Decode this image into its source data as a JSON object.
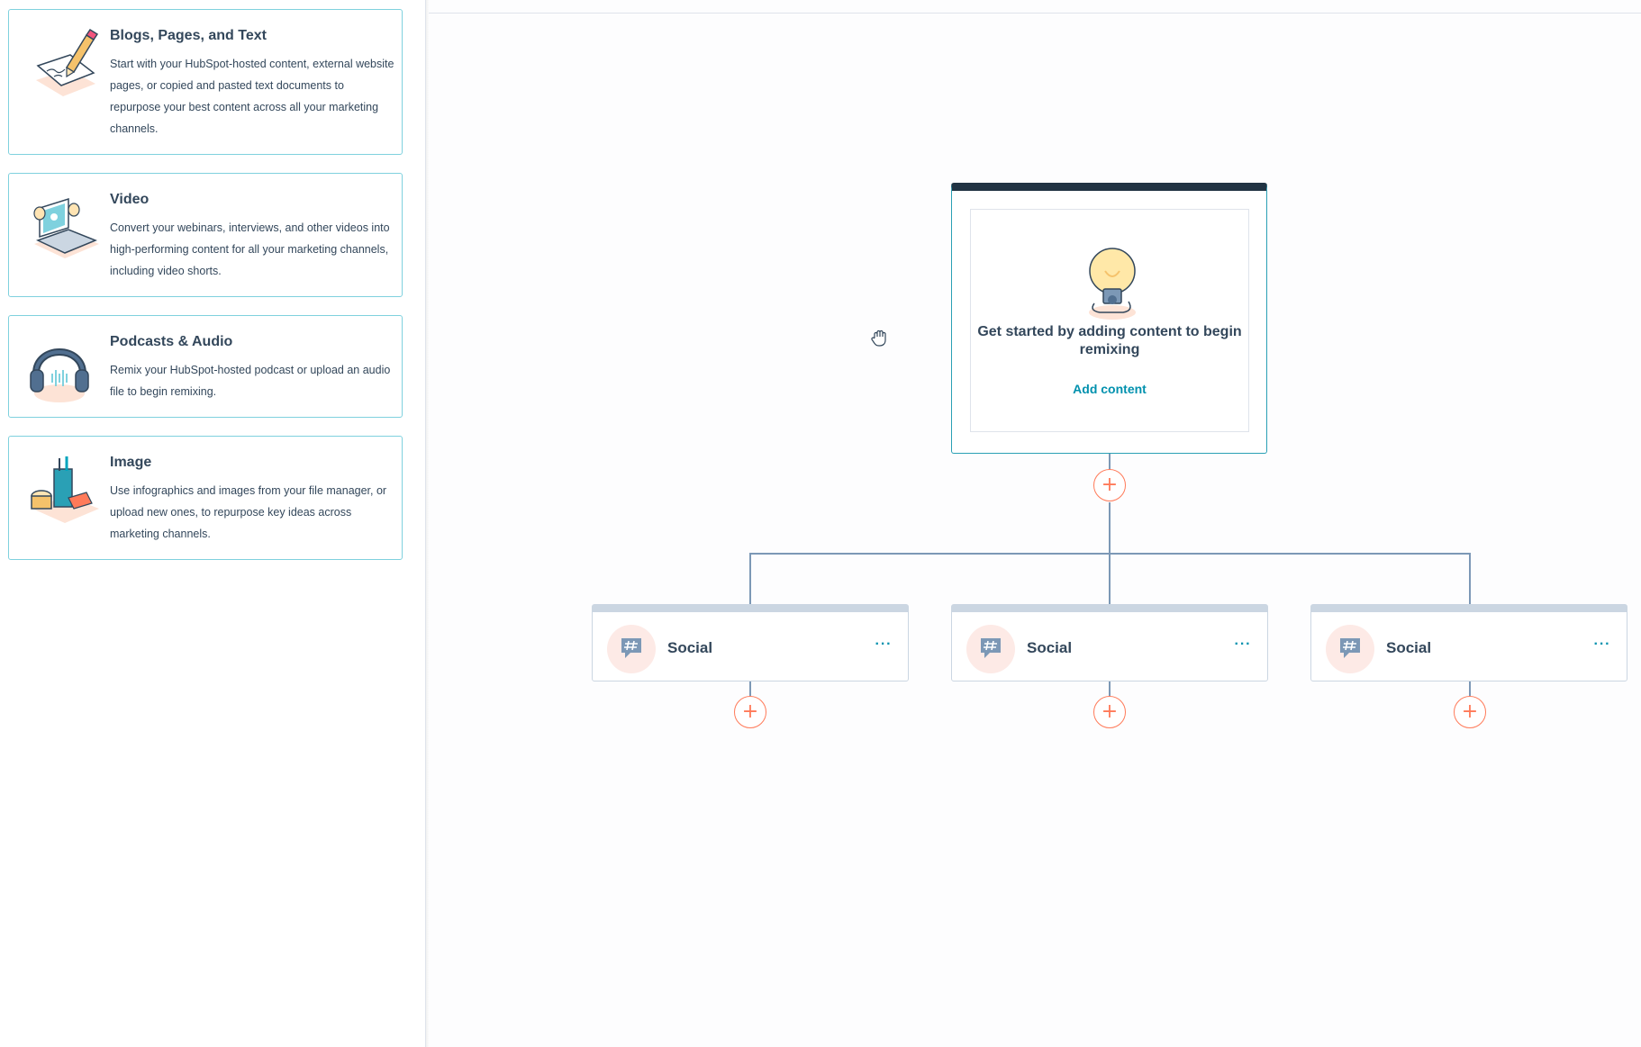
{
  "content_types": [
    {
      "title": "Blogs, Pages, and Text",
      "description": "Start with your HubSpot-hosted content, external website pages, or copied and pasted text documents to repurpose your best content across all your marketing channels.",
      "icon": "pencil-document-icon"
    },
    {
      "title": "Video",
      "description": "Convert your webinars, interviews, and other videos into high-performing content for all your marketing channels, including video shorts.",
      "icon": "laptop-video-icon"
    },
    {
      "title": "Podcasts & Audio",
      "description": "Remix your HubSpot-hosted podcast or upload an audio file to begin remixing.",
      "icon": "headphones-icon"
    },
    {
      "title": "Image",
      "description": "Use infographics and images from your file manager, or upload new ones, to repurpose key ideas across marketing channels.",
      "icon": "art-supplies-icon"
    }
  ],
  "remix": {
    "main_card": {
      "title": "Get started by adding content to begin remixing",
      "action": "Add content",
      "icon": "lightbulb-icon"
    },
    "outputs": [
      {
        "label": "Social",
        "menu": "···",
        "icon": "social-hashtag-icon"
      },
      {
        "label": "Social",
        "menu": "···",
        "icon": "social-hashtag-icon"
      },
      {
        "label": "Social",
        "menu": "···",
        "icon": "social-hashtag-icon"
      }
    ],
    "add_symbol": "+"
  },
  "colors": {
    "card_border": "#7fd1de",
    "main_card_header": "#213343",
    "link": "#0091ae",
    "accent": "#ff7a59",
    "connector": "#7c98b6",
    "text": "#33475b"
  }
}
